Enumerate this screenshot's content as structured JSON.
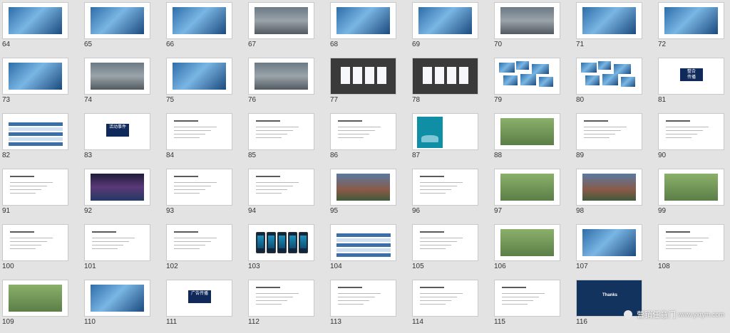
{
  "app": {
    "view": "slide sorter"
  },
  "slides": [
    {
      "num": "64",
      "kind": "photo-blue"
    },
    {
      "num": "65",
      "kind": "photo-blue"
    },
    {
      "num": "66",
      "kind": "photo-blue"
    },
    {
      "num": "67",
      "kind": "photo-street"
    },
    {
      "num": "68",
      "kind": "photo-blue"
    },
    {
      "num": "69",
      "kind": "photo-blue"
    },
    {
      "num": "70",
      "kind": "photo-street"
    },
    {
      "num": "71",
      "kind": "photo-blue"
    },
    {
      "num": "72",
      "kind": "photo-blue"
    },
    {
      "num": "73",
      "kind": "photo-blue"
    },
    {
      "num": "74",
      "kind": "photo-street"
    },
    {
      "num": "75",
      "kind": "photo-blue"
    },
    {
      "num": "76",
      "kind": "photo-street"
    },
    {
      "num": "77",
      "kind": "dark-panel"
    },
    {
      "num": "78",
      "kind": "dark-panel"
    },
    {
      "num": "79",
      "kind": "collage"
    },
    {
      "num": "80",
      "kind": "collage"
    },
    {
      "num": "81",
      "kind": "title-box",
      "text": "整合\n传播"
    },
    {
      "num": "82",
      "kind": "table"
    },
    {
      "num": "83",
      "kind": "title-box",
      "text": "活动事件"
    },
    {
      "num": "84",
      "kind": "text"
    },
    {
      "num": "85",
      "kind": "text"
    },
    {
      "num": "86",
      "kind": "text"
    },
    {
      "num": "87",
      "kind": "teal"
    },
    {
      "num": "88",
      "kind": "photo-green"
    },
    {
      "num": "89",
      "kind": "text"
    },
    {
      "num": "90",
      "kind": "text"
    },
    {
      "num": "91",
      "kind": "text"
    },
    {
      "num": "92",
      "kind": "photo-dark"
    },
    {
      "num": "93",
      "kind": "text"
    },
    {
      "num": "94",
      "kind": "text"
    },
    {
      "num": "95",
      "kind": "photo-crowd"
    },
    {
      "num": "96",
      "kind": "text"
    },
    {
      "num": "97",
      "kind": "photo-green"
    },
    {
      "num": "98",
      "kind": "photo-crowd"
    },
    {
      "num": "99",
      "kind": "photo-green"
    },
    {
      "num": "100",
      "kind": "text"
    },
    {
      "num": "101",
      "kind": "text"
    },
    {
      "num": "102",
      "kind": "text"
    },
    {
      "num": "103",
      "kind": "phones"
    },
    {
      "num": "104",
      "kind": "table"
    },
    {
      "num": "105",
      "kind": "text"
    },
    {
      "num": "106",
      "kind": "photo-green"
    },
    {
      "num": "107",
      "kind": "photo-blue"
    },
    {
      "num": "108",
      "kind": "text"
    },
    {
      "num": "109",
      "kind": "photo-green"
    },
    {
      "num": "110",
      "kind": "photo-blue"
    },
    {
      "num": "111",
      "kind": "title-box",
      "text": "广告传播"
    },
    {
      "num": "112",
      "kind": "text"
    },
    {
      "num": "113",
      "kind": "text"
    },
    {
      "num": "114",
      "kind": "text"
    },
    {
      "num": "115",
      "kind": "text"
    },
    {
      "num": "116",
      "kind": "thanks",
      "text": "Thanks"
    },
    {
      "num": "",
      "kind": "empty"
    }
  ],
  "watermark": {
    "brand": "营销任意门",
    "url": "www.yxrym.com"
  }
}
